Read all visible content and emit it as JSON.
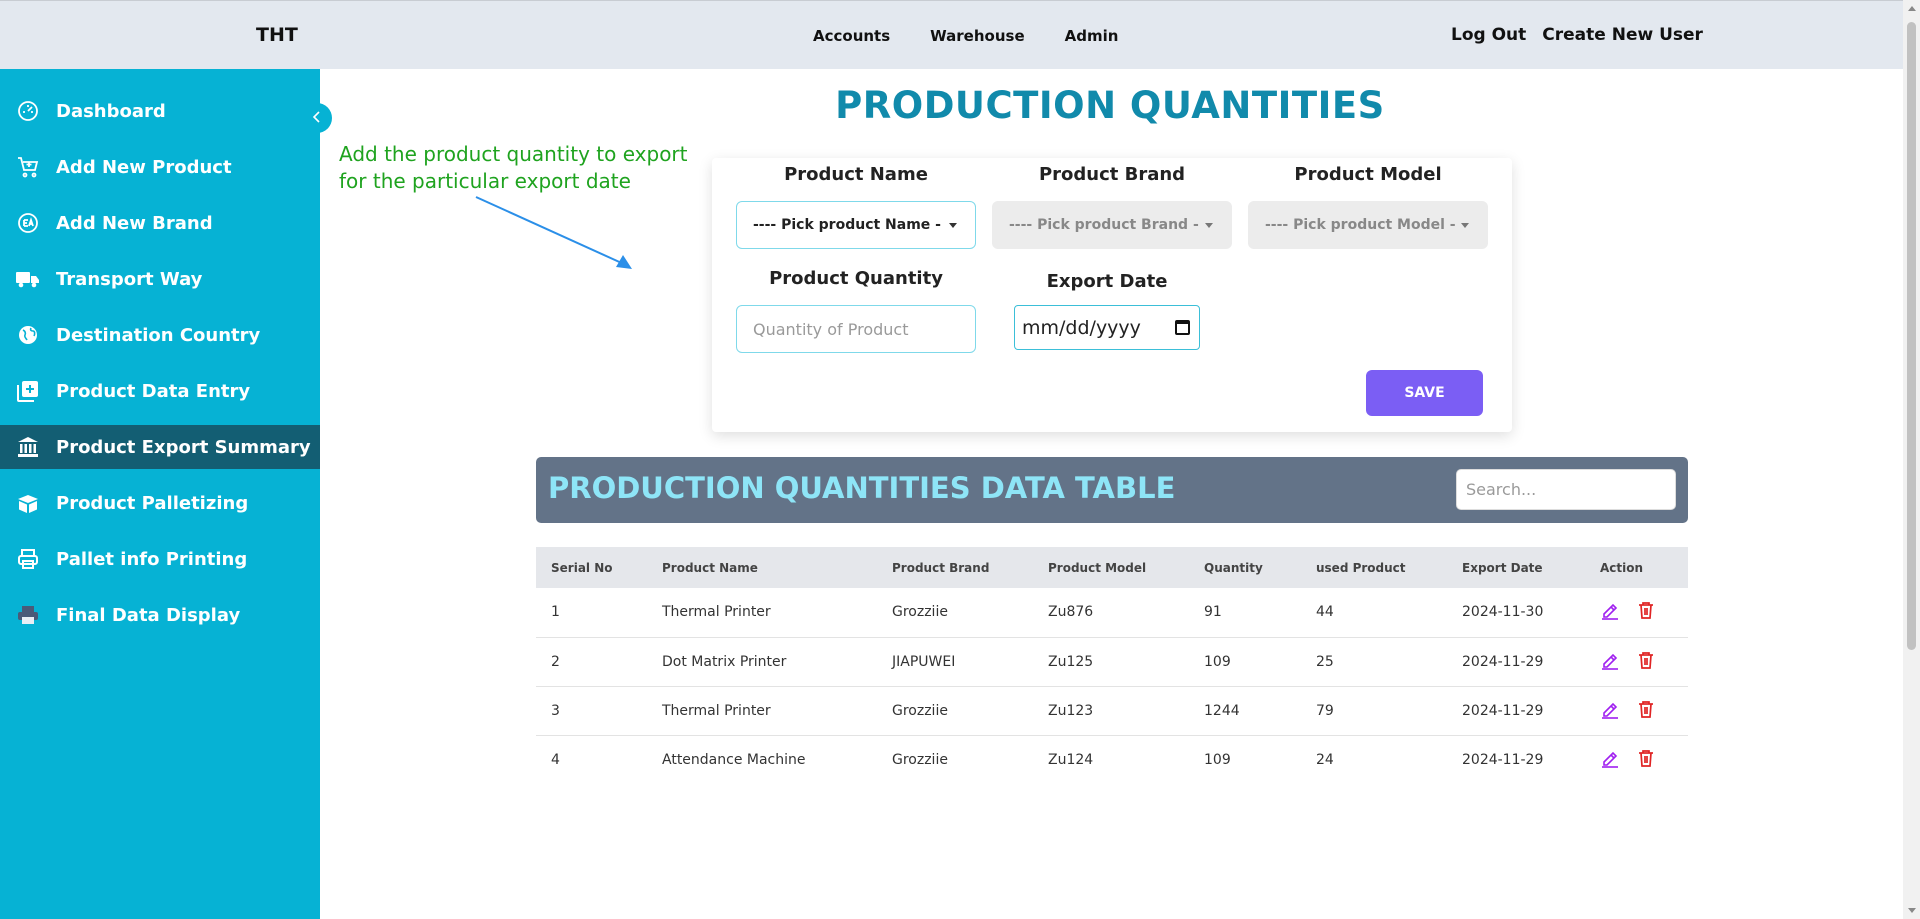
{
  "header": {
    "brand": "THT",
    "nav": [
      "Accounts",
      "Warehouse",
      "Admin"
    ],
    "logout_label": "Log Out",
    "create_user_label": "Create New User"
  },
  "sidebar": {
    "items": [
      {
        "label": "Dashboard",
        "icon": "dashboard-icon"
      },
      {
        "label": "Add New Product",
        "icon": "cart-icon"
      },
      {
        "label": "Add New Brand",
        "icon": "brand-icon"
      },
      {
        "label": "Transport Way",
        "icon": "truck-icon"
      },
      {
        "label": "Destination Country",
        "icon": "globe-icon"
      },
      {
        "label": "Product Data Entry",
        "icon": "add-box-icon"
      },
      {
        "label": "Product Export Summary",
        "icon": "bank-icon",
        "active": true
      },
      {
        "label": "Product Palletizing",
        "icon": "package-icon"
      },
      {
        "label": "Pallet info Printing",
        "icon": "printer-icon"
      },
      {
        "label": "Final Data Display",
        "icon": "printer-icon"
      }
    ]
  },
  "page": {
    "title": "PRODUCTION QUANTITIES",
    "annotation": "Add the product quantity to export for the particular export date"
  },
  "form": {
    "product_name_label": "Product Name",
    "product_name_value": "---- Pick product Name -",
    "product_brand_label": "Product Brand",
    "product_brand_value": "---- Pick product Brand -",
    "product_model_label": "Product Model",
    "product_model_value": "---- Pick product Model -",
    "quantity_label": "Product Quantity",
    "quantity_placeholder": "Quantity of Product",
    "export_date_label": "Export Date",
    "export_date_value": "mm/dd/yyyy",
    "save_label": "SAVE"
  },
  "table": {
    "title": "PRODUCTION QUANTITIES DATA TABLE",
    "search_placeholder": "Search...",
    "columns": [
      "Serial No",
      "Product Name",
      "Product Brand",
      "Product Model",
      "Quantity",
      "used Product",
      "Export Date",
      "Action"
    ],
    "rows": [
      [
        "1",
        "Thermal Printer",
        "Grozziie",
        "Zu876",
        "91",
        "44",
        "2024-11-30"
      ],
      [
        "2",
        "Dot Matrix Printer",
        "JIAPUWEI",
        "Zu125",
        "109",
        "25",
        "2024-11-29"
      ],
      [
        "3",
        "Thermal Printer",
        "Grozziie",
        "Zu123",
        "1244",
        "79",
        "2024-11-29"
      ],
      [
        "4",
        "Attendance Machine",
        "Grozziie",
        "Zu124",
        "109",
        "24",
        "2024-11-29"
      ]
    ]
  },
  "colors": {
    "sidebar": "#06b2d4",
    "sidebar_active": "#135e73",
    "accent": "#118aab",
    "save_button": "#7b5ef4",
    "table_bar": "#637388",
    "edit_icon": "#a020f0",
    "delete_icon": "#e02424",
    "annotation": "#1fa31f"
  }
}
